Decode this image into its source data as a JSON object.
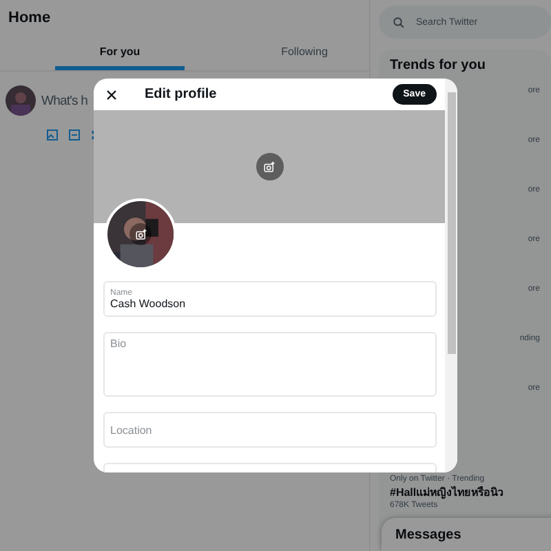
{
  "header": {
    "title": "Home"
  },
  "tabs": [
    {
      "label": "For you",
      "selected": true
    },
    {
      "label": "Following",
      "selected": false
    }
  ],
  "composer": {
    "placeholder": "What's h"
  },
  "search": {
    "placeholder": "Search Twitter"
  },
  "trends": {
    "title": "Trends for you",
    "fragments": [
      "ore",
      "ore",
      "ore",
      "ore",
      "ore",
      "nding",
      "ore"
    ],
    "items": [
      {
        "context": "Only on Twitter · Trending",
        "tag": "#Hallแม่หญิงไทยหรือนิว",
        "count": "678K Tweets"
      }
    ]
  },
  "messages": {
    "title": "Messages"
  },
  "modal": {
    "title": "Edit profile",
    "save": "Save",
    "fields": [
      {
        "label": "Name",
        "value": "Cash Woodson"
      },
      {
        "label": "Bio"
      },
      {
        "label": "Location"
      }
    ]
  }
}
